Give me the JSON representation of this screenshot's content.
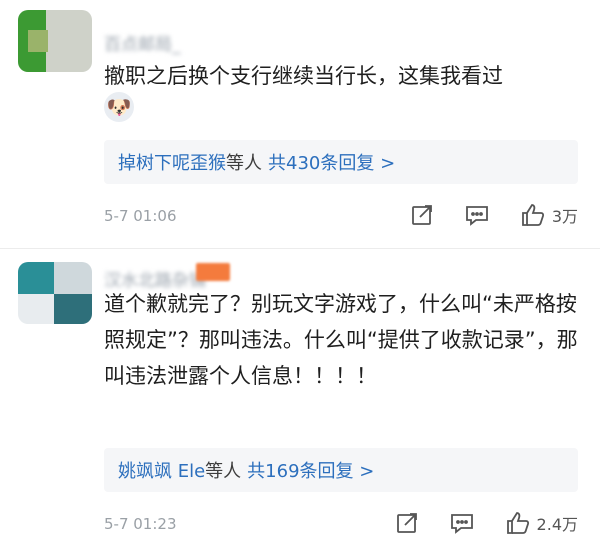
{
  "comments": [
    {
      "username": "百点邮局_",
      "body": "撤职之后换个支行继续当行长，这集我看过",
      "emoji": "🐶",
      "replies_names": "掉树下呢歪猴",
      "replies_text": "等人",
      "replies_count": "共430条回复 >",
      "time": "5-7 01:06",
      "likes": "3万"
    },
    {
      "username": "汉水北路杂铺",
      "body": "道个歉就完了？别玩文字游戏了，什么叫“未严格按照规定”？那叫违法。什么叫“提供了收款记录”，那叫违法泄露个人信息！！！！",
      "replies_names": "姚飒飒 Ele",
      "replies_text": "等人",
      "replies_count": "共169条回复 >",
      "time": "5-7 01:23",
      "likes": "2.4万"
    }
  ],
  "icons": {
    "share": "share-icon",
    "comment": "comment-icon",
    "like": "thumbs-up-icon"
  },
  "colors": {
    "link": "#2c6fbd",
    "muted": "#9aa0a6",
    "reply_bg": "#f5f6f8"
  }
}
